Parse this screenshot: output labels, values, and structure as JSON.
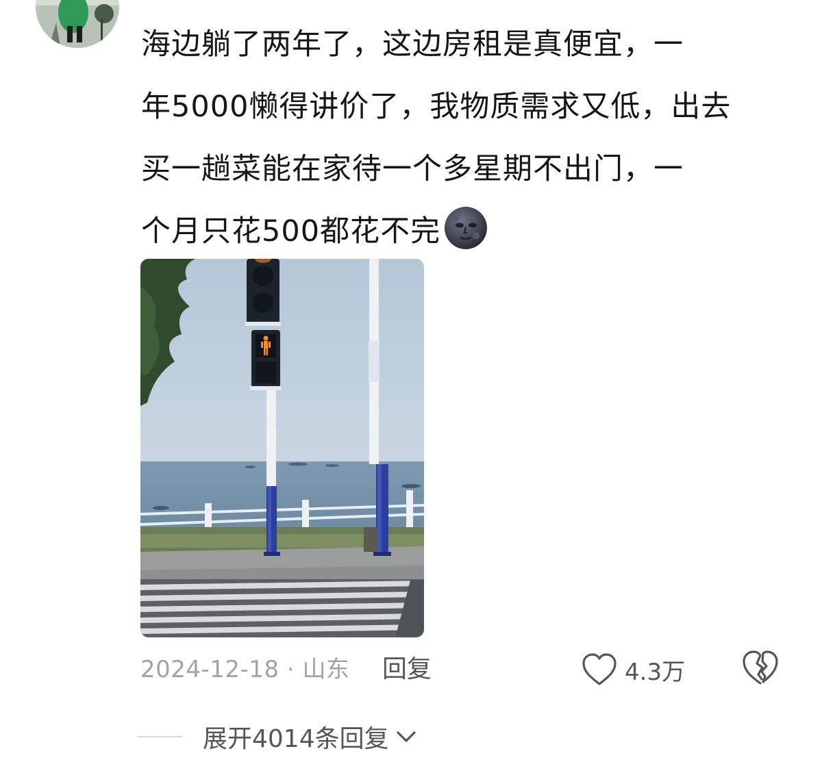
{
  "comment": {
    "lines": [
      "海边躺了两年了，这边房租是真便宜，一",
      "年5000懒得讲价了，我物质需求又低，出去",
      "买一趟菜能在家待一个多星期不出门，一",
      "个月只花500都花不完"
    ],
    "emoji": "new-moon-face-emoji"
  },
  "meta": {
    "date": "2024-12-18",
    "separator": "·",
    "location": "山东",
    "reply_label": "回复",
    "like_count": "4.3万"
  },
  "expand": {
    "label": "展开4014条回复"
  },
  "icons": {
    "like": "heart-outline-icon",
    "dislike": "broken-heart-icon",
    "expand": "chevron-down-icon"
  },
  "colors": {
    "text": "#161616",
    "meta": "#a2a2a2",
    "action": "#555555",
    "pole_blue": "#2b3f9e",
    "signal_orange": "#ff8a1e"
  }
}
